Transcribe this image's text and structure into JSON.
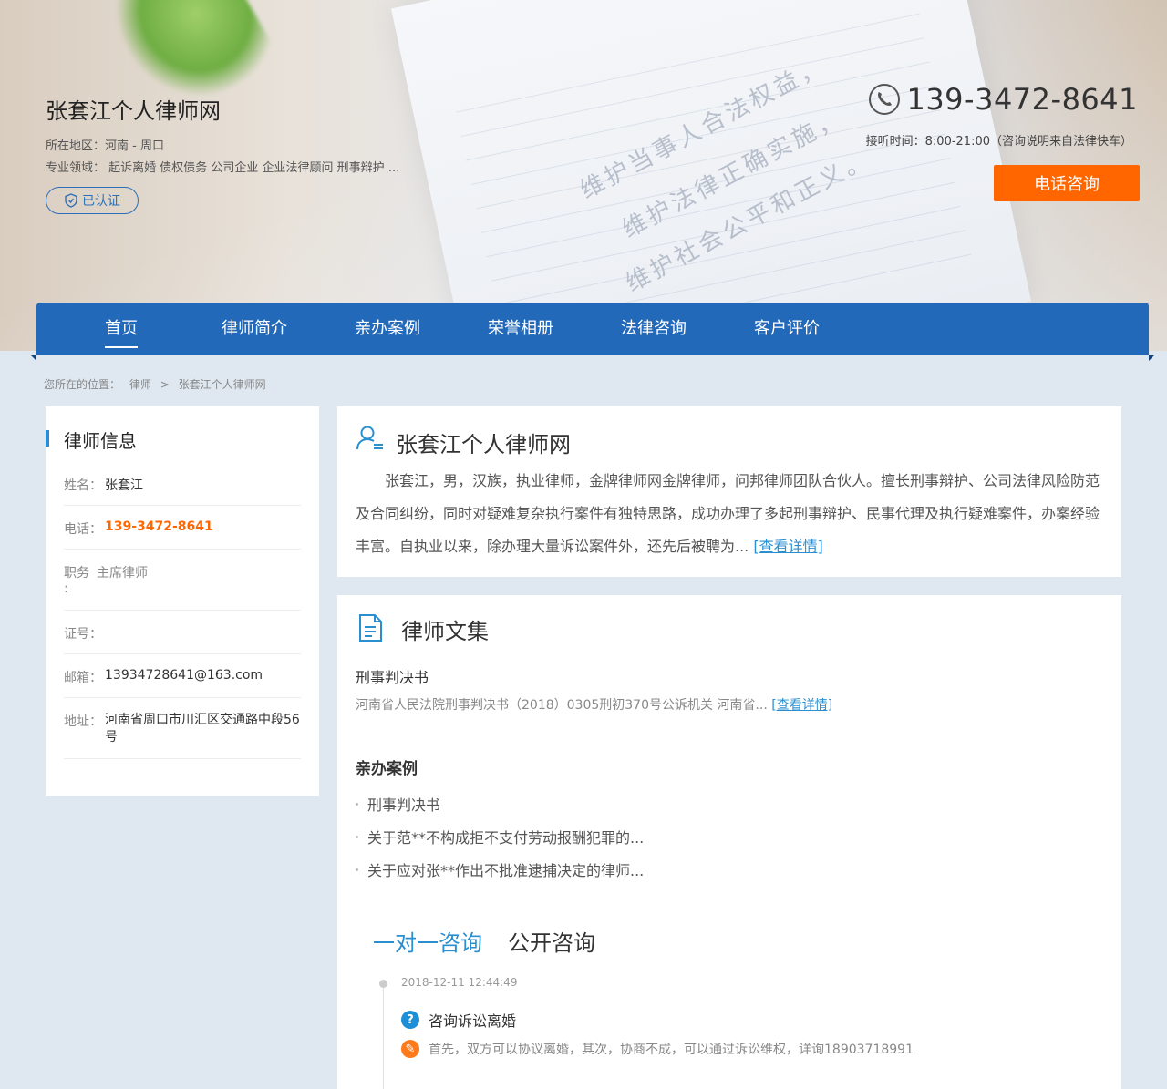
{
  "header": {
    "site_title": "张套江个人律师网",
    "region_label": "所在地区：",
    "region_value": "河南 - 周口",
    "fields_label": "专业领域：",
    "fields_value": "起诉离婚 债权债务 公司企业 企业法律顾问 刑事辩护 ...",
    "certified": "已认证",
    "phone": "139-3472-8641",
    "hours": "接听时间：8:00-21:00（咨询说明来自法律快车）",
    "call_button": "电话咨询",
    "slogan_lines": [
      "维护当事人合法权益，",
      "维护法律正确实施，",
      "维护社会公平和正义。"
    ]
  },
  "nav": {
    "items": [
      "首页",
      "律师简介",
      "亲办案例",
      "荣誉相册",
      "法律咨询",
      "客户评价"
    ],
    "active": "首页"
  },
  "breadcrumb": {
    "label": "您所在的位置：",
    "items": [
      "律师",
      ">",
      "张套江个人律师网"
    ]
  },
  "lawyer_info": {
    "title": "律师信息",
    "rows": [
      {
        "k": "姓名：",
        "v": "张套江"
      },
      {
        "k": "电话：",
        "v": "139-3472-8641"
      },
      {
        "k": "职务 :",
        "v": "主席律师"
      },
      {
        "k": "证号：",
        "v": ""
      },
      {
        "k": "邮箱：",
        "v": "13934728641@163.com"
      },
      {
        "k": "地址：",
        "v": "河南省周口市川汇区交通路中段56号"
      }
    ]
  },
  "intro": {
    "title": "张套江个人律师网",
    "text": "张套江，男，汉族，执业律师，金牌律师网金牌律师，问邦律师团队合伙人。擅长刑事辩护、公司法律风险防范及合同纠纷，同时对疑难复杂执行案件有独特思路，成功办理了多起刑事辩护、民事代理及执行疑难案件，办案经验丰富。自执业以来，除办理大量诉讼案件外，还先后被聘为...",
    "more": "[查看详情]"
  },
  "articles": {
    "title": "律师文集",
    "item_title": "刑事判决书",
    "item_summary": "河南省人民法院刑事判决书（2018）0305刑初370号公诉机关  河南省...",
    "more": "[查看详情]",
    "cases_title": "亲办案例",
    "cases": [
      "刑事判决书",
      "关于范**不构成拒不支付劳动报酬犯罪的...",
      "关于应对张**作出不批准逮捕决定的律师..."
    ]
  },
  "consult": {
    "tab_active": "一对一咨询",
    "tab_other": "公开咨询",
    "time": "2018-12-11 12:44:49",
    "question_icon": "?",
    "question": "咨询诉讼离婚",
    "answer_icon": "✎",
    "answer": "首先，双方可以协议离婚，其次，协商不成，可以通过诉讼维权，详询18903718991"
  },
  "colors": {
    "nav_blue": "#2369b9",
    "accent_orange": "#ff6600",
    "link_blue": "#2a8fd1"
  }
}
